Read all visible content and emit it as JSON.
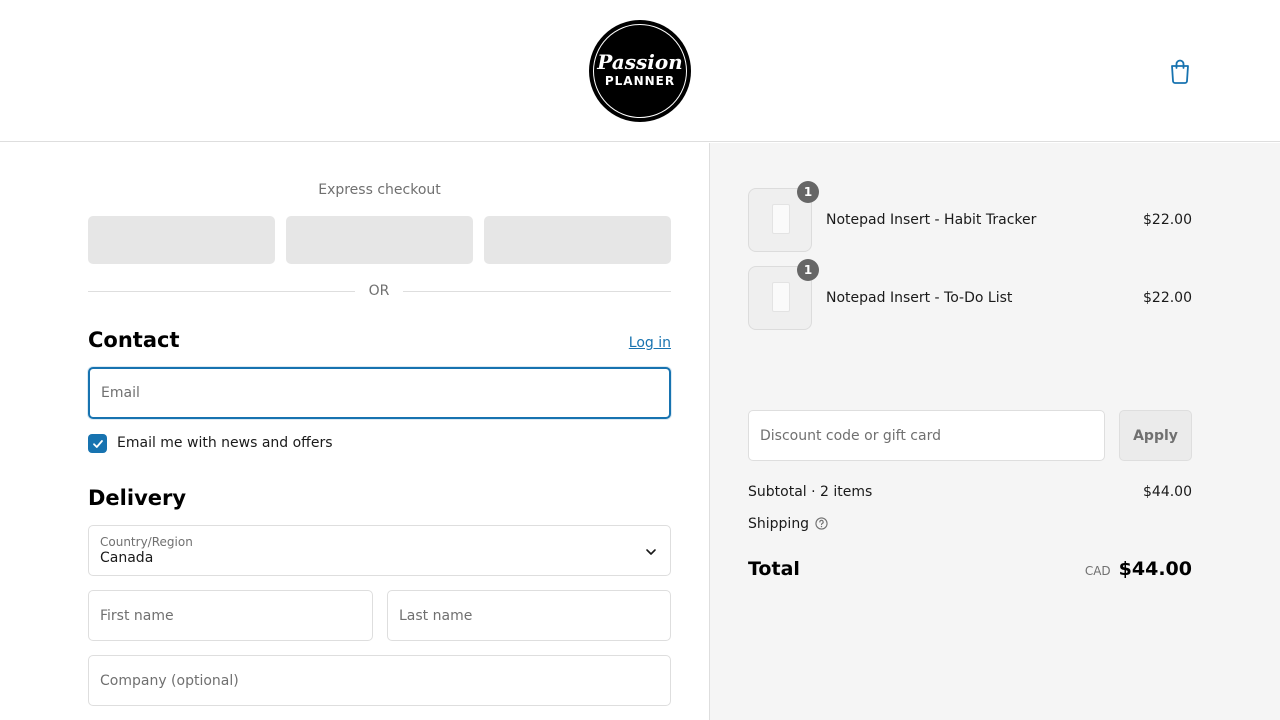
{
  "header": {
    "logo": {
      "script_text": "Passion",
      "caps_text": "PLANNER"
    },
    "cart_icon": "shopping-bag-icon",
    "accent_color": "#1773b0"
  },
  "express": {
    "label": "Express checkout",
    "buttons": [
      "",
      "",
      ""
    ],
    "or_label": "OR"
  },
  "contact": {
    "title": "Contact",
    "login_label": "Log in",
    "email_placeholder": "Email",
    "email_value": "",
    "newsletter_label": "Email me with news and offers",
    "newsletter_checked": true
  },
  "delivery": {
    "title": "Delivery",
    "country_label": "Country/Region",
    "country_value": "Canada",
    "first_name_placeholder": "First name",
    "last_name_placeholder": "Last name",
    "company_placeholder": "Company (optional)"
  },
  "summary": {
    "items": [
      {
        "name": "Notepad Insert - Habit Tracker",
        "price": "$22.00",
        "qty": "1"
      },
      {
        "name": "Notepad Insert - To-Do List",
        "price": "$22.00",
        "qty": "1"
      }
    ],
    "discount_placeholder": "Discount code or gift card",
    "apply_label": "Apply",
    "subtotal_label": "Subtotal · 2 items",
    "subtotal_value": "$44.00",
    "shipping_label": "Shipping",
    "total_label": "Total",
    "currency": "CAD",
    "total_value": "$44.00"
  }
}
